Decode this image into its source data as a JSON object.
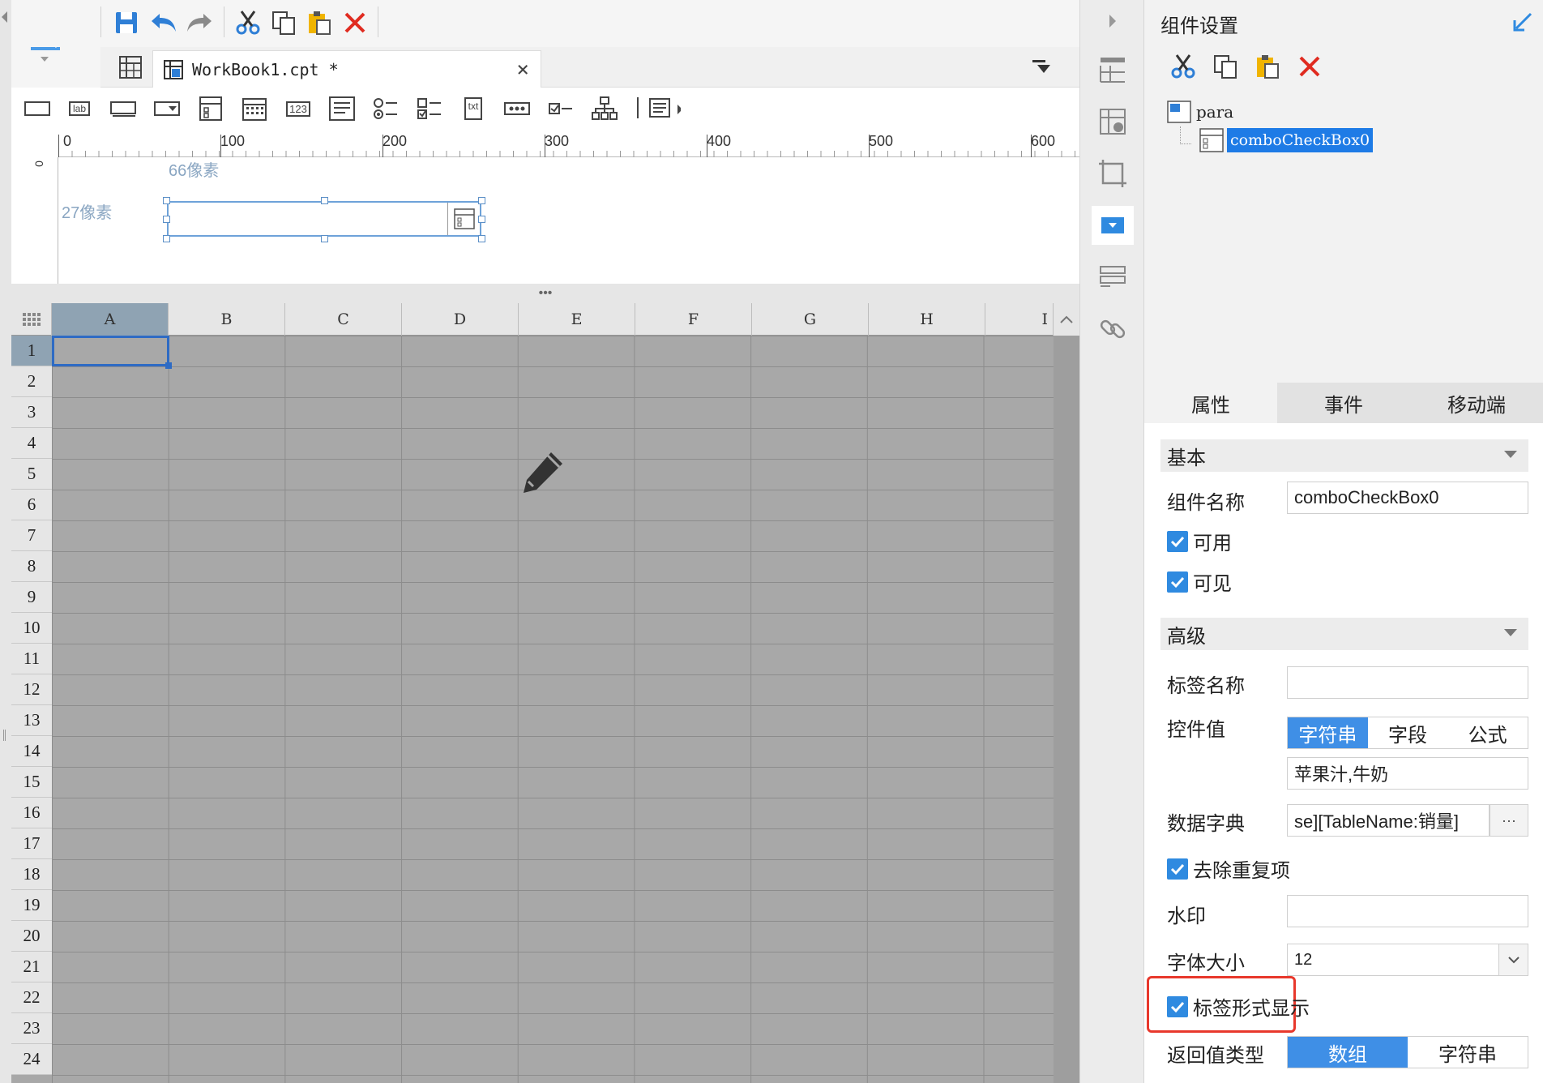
{
  "doc_tab": {
    "title": "WorkBook1.cpt *",
    "close": "×"
  },
  "ruler": {
    "ticks": [
      "0",
      "100",
      "200",
      "300",
      "400",
      "500",
      "600"
    ],
    "v_zero": "0"
  },
  "canvas": {
    "width_label": "66像素",
    "height_label": "27像素"
  },
  "splitter": {
    "dots": "•••"
  },
  "sheet": {
    "columns": [
      "A",
      "B",
      "C",
      "D",
      "E",
      "F",
      "G",
      "H",
      "I"
    ],
    "rows": [
      "1",
      "2",
      "3",
      "4",
      "5",
      "6",
      "7",
      "8",
      "9",
      "10",
      "11",
      "12",
      "13",
      "14",
      "15",
      "16",
      "17",
      "18",
      "19",
      "20",
      "21",
      "22",
      "23",
      "24"
    ],
    "selected_cell": "A1"
  },
  "widgets_bar": {
    "icons": [
      "textfield-icon",
      "label-icon",
      "button-icon",
      "combobox-icon",
      "combocheckbox-icon",
      "date-icon",
      "number-icon",
      "textarea-icon",
      "radio-group-icon",
      "checkbox-group-icon",
      "text-icon",
      "password-icon",
      "checkbox-icon",
      "tree-icon",
      "more-widgets-icon"
    ],
    "label_lab": "lab",
    "label_123": "123",
    "label_txt": "txt"
  },
  "panel": {
    "title": "组件设置",
    "tree": {
      "root": "para",
      "child": "comboCheckBox0"
    },
    "tabs": [
      "属性",
      "事件",
      "移动端"
    ],
    "active_tab": 0,
    "basic_section": "基本",
    "component_name_label": "组件名称",
    "component_name_value": "comboCheckBox0",
    "enabled_label": "可用",
    "enabled": true,
    "visible_label": "可见",
    "visible": true,
    "advanced_section": "高级",
    "label_name_label": "标签名称",
    "label_name_value": "",
    "control_value_label": "控件值",
    "control_value_modes": [
      "字符串",
      "字段",
      "公式"
    ],
    "control_value_mode_selected": 0,
    "control_value_value": "苹果汁,牛奶",
    "data_dict_label": "数据字典",
    "data_dict_value": "se][TableName:销量]",
    "data_dict_more": "···",
    "remove_dup_label": "去除重复项",
    "remove_dup": true,
    "watermark_label": "水印",
    "watermark_value": "",
    "font_size_label": "字体大小",
    "font_size_value": "12",
    "tag_display_label": "标签形式显示",
    "tag_display": true,
    "return_type_label": "返回值类型",
    "return_type_options": [
      "数组",
      "字符串"
    ],
    "return_type_selected": 0
  },
  "colors": {
    "accent": "#3f8fe6",
    "selection": "#1e7be6",
    "highlight_box": "#e8382c",
    "delete_red": "#e02b20"
  }
}
